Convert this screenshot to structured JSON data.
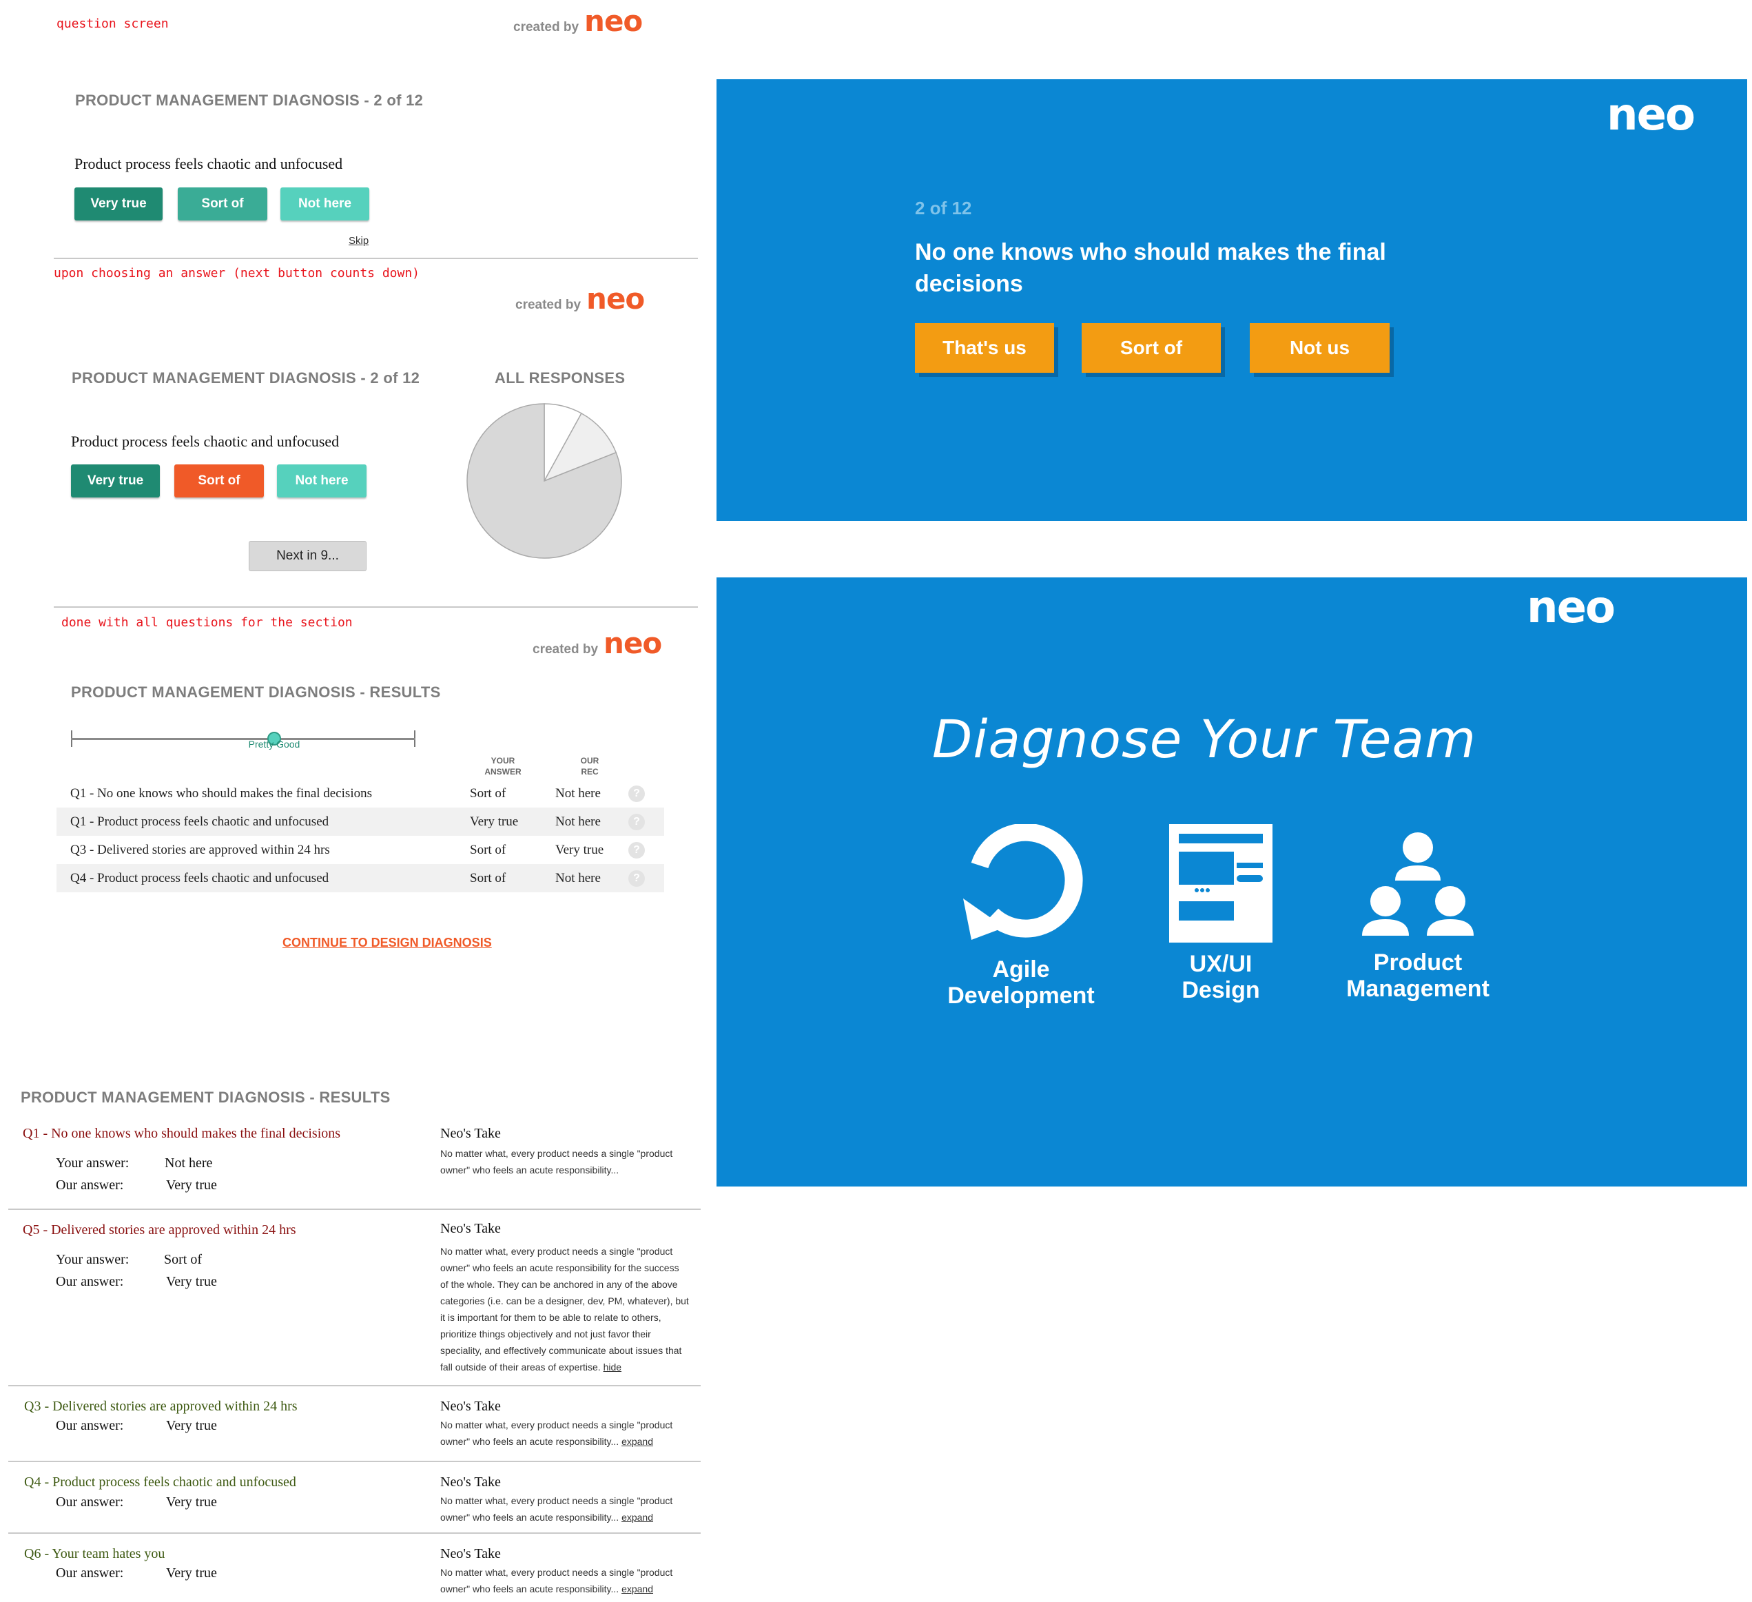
{
  "notes": {
    "question_screen": "question screen",
    "upon_choosing": "upon choosing an answer (next button counts down)",
    "done": "done with all questions for the section"
  },
  "credit": {
    "by": "created by",
    "logo": "neo"
  },
  "screen1": {
    "heading": "PRODUCT MANAGEMENT DIAGNOSIS - 2 of 12",
    "question": "Product process feels chaotic and unfocused",
    "buttons": [
      "Very true",
      "Sort of",
      "Not here"
    ],
    "skip": "Skip"
  },
  "screen2": {
    "heading": "PRODUCT MANAGEMENT DIAGNOSIS - 2 of 12",
    "question": "Product process feels chaotic and unfocused",
    "buttons": [
      "Very true",
      "Sort of",
      "Not here"
    ],
    "next": "Next in 9...",
    "all_responses": "ALL RESPONSES"
  },
  "chart_data": {
    "type": "pie",
    "title": "ALL RESPONSES",
    "values": [
      8,
      11,
      81
    ],
    "colors": [
      "#ffffff",
      "#efefef",
      "#d8d8d8"
    ]
  },
  "screen3": {
    "heading": "PRODUCT MANAGEMENT DIAGNOSIS - RESULTS",
    "scale_label": "Pretty Good",
    "scale_level": 0.59,
    "col_your": [
      "YOUR",
      "ANSWER"
    ],
    "col_rec": [
      "OUR",
      "REC"
    ],
    "rows": [
      {
        "q": "Q1 - No one knows who should makes the final decisions",
        "a": "Sort of",
        "r": "Not here"
      },
      {
        "q": "Q1 - Product process feels chaotic and unfocused",
        "a": "Very true",
        "r": "Not here"
      },
      {
        "q": "Q3 - Delivered stories are approved within 24 hrs",
        "a": "Sort of",
        "r": "Very true"
      },
      {
        "q": "Q4 - Product process feels chaotic and unfocused",
        "a": "Sort of",
        "r": "Not here"
      }
    ],
    "qmark": "?",
    "continue": "CONTINUE TO DESIGN DIAGNOSIS"
  },
  "screen4": {
    "heading": "PRODUCT MANAGEMENT DIAGNOSIS - RESULTS",
    "your_label": "Your answer:",
    "our_label": "Our answer:",
    "take_title": "Neo's Take",
    "items": [
      {
        "q": "Q1 - No one knows who should makes the final decisions",
        "your": "Not here",
        "our": "Very true",
        "take": "No matter what, every product needs a single \"product owner\" who feels an acute responsibility...",
        "link": ""
      },
      {
        "q": "Q5 - Delivered stories are approved within 24 hrs",
        "your": "Sort of",
        "our": "Very true",
        "take": "No matter what, every product needs a single \"product owner\" who feels an acute responsibility for the success of the whole. They can be anchored in any of the above categories (i.e. can be a designer, dev, PM, whatever), but it is important for them to be able to relate to others, prioritize  things objectively and not just favor their speciality, and effectively communicate  about issues that fall outside of their areas of expertise.",
        "link": "hide"
      },
      {
        "q": "Q3 - Delivered stories are approved within 24 hrs",
        "our": "Very true",
        "take": "No matter what, every product needs a single \"product owner\" who feels an acute responsibility...",
        "link": "expand"
      },
      {
        "q": "Q4 - Product process feels chaotic and unfocused",
        "our": "Very true",
        "take": "No matter what, every product needs a single \"product owner\" who feels an acute responsibility...",
        "link": "expand"
      },
      {
        "q": "Q6 - Your team hates you",
        "our": "Very true",
        "take": "No matter what, every product needs a single \"product owner\" who feels an acute responsibility...",
        "link": "expand"
      }
    ]
  },
  "blue1": {
    "logo": "neo",
    "progress": "2 of 12",
    "question_line1": "No one knows who should makes the final",
    "question_line2": "decisions",
    "buttons": [
      "That's us",
      "Sort of",
      "Not us"
    ]
  },
  "blue2": {
    "logo": "neo",
    "title": "Diagnose Your Team",
    "services": [
      {
        "line1": "Agile",
        "line2": "Development",
        "icon": "refresh-icon"
      },
      {
        "line1": "UX/UI",
        "line2": "Design",
        "icon": "wireframe-icon"
      },
      {
        "line1": "Product",
        "line2": "Management",
        "icon": "team-icon"
      }
    ]
  },
  "colors": {
    "teal_dark": "#1f8a72",
    "teal_mid": "#3aac96",
    "teal_light": "#56d1bd",
    "orange": "#f05a28",
    "blue_panel": "#0b87d3",
    "amber": "#f39c12"
  }
}
